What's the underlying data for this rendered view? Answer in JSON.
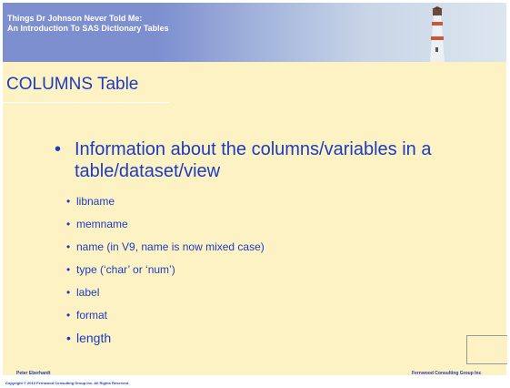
{
  "header": {
    "title_line1": "Things Dr Johnson Never Told Me:",
    "title_line2": "An Introduction To SAS Dictionary Tables"
  },
  "slide_title": "COLUMNS Table",
  "main_bullet": "Information about the columns/variables in a table/dataset/view",
  "sub_bullets": [
    "libname",
    "memname",
    "name (in V9, name is now mixed case)",
    "type (‘char’ or ‘num’)",
    "label",
    "format",
    "length"
  ],
  "footer": {
    "left": "Peter Eberhardt",
    "right": "Fernwood Consulting Group Inc",
    "copyright": "Copyright © 2010 Fernwood Consulting Group Inc. All Rights Reserved."
  },
  "colors": {
    "banner": "#7d8fcf",
    "background": "#fdf2c4",
    "text_blue": "#1c3cbf"
  },
  "icons": {
    "bullet": "•",
    "lighthouse": "lighthouse-icon"
  }
}
